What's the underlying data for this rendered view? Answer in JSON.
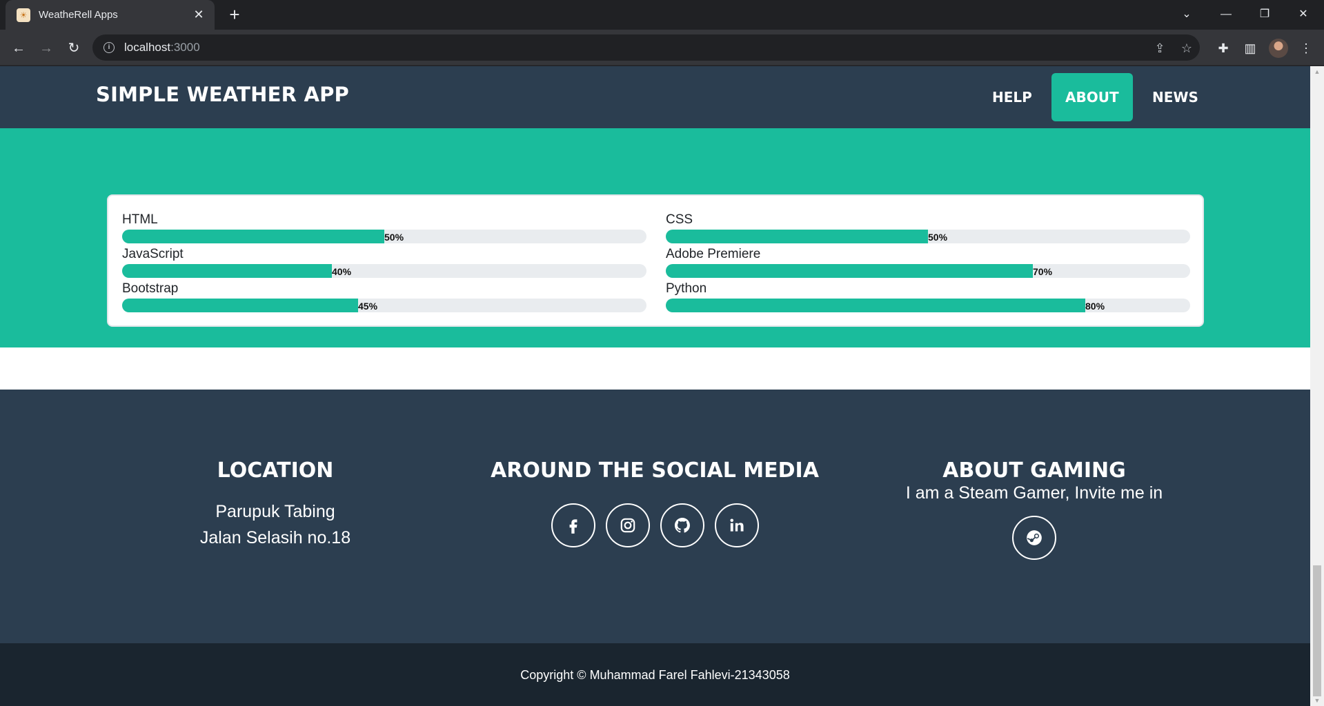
{
  "browser": {
    "tab_title": "WeatheRell Apps",
    "url_host": "localhost",
    "url_port": ":3000"
  },
  "nav": {
    "brand": "SIMPLE WEATHER APP",
    "links": [
      {
        "label": "HELP",
        "active": false
      },
      {
        "label": "ABOUT",
        "active": true
      },
      {
        "label": "NEWS",
        "active": false
      }
    ]
  },
  "skills": [
    {
      "name": "HTML",
      "percent": 50,
      "label": "50%"
    },
    {
      "name": "CSS",
      "percent": 50,
      "label": "50%"
    },
    {
      "name": "JavaScript",
      "percent": 40,
      "label": "40%"
    },
    {
      "name": "Adobe Premiere",
      "percent": 70,
      "label": "70%"
    },
    {
      "name": "Bootstrap",
      "percent": 45,
      "label": "45%"
    },
    {
      "name": "Python",
      "percent": 80,
      "label": "80%"
    }
  ],
  "footer": {
    "location": {
      "title": "LOCATION",
      "line1": "Parupuk Tabing",
      "line2": "Jalan Selasih no.18"
    },
    "social": {
      "title": "AROUND THE SOCIAL MEDIA",
      "icons": [
        "facebook-icon",
        "instagram-icon",
        "github-icon",
        "linkedin-icon"
      ]
    },
    "gaming": {
      "title": "ABOUT GAMING",
      "text": "I am a Steam Gamer, Invite me in",
      "icon": "steam-icon"
    },
    "copyright": "Copyright © Muhammad Farel Fahlevi-21343058"
  },
  "colors": {
    "accent": "#1abc9c",
    "navy": "#2c3e50",
    "dark": "#1a252f"
  }
}
